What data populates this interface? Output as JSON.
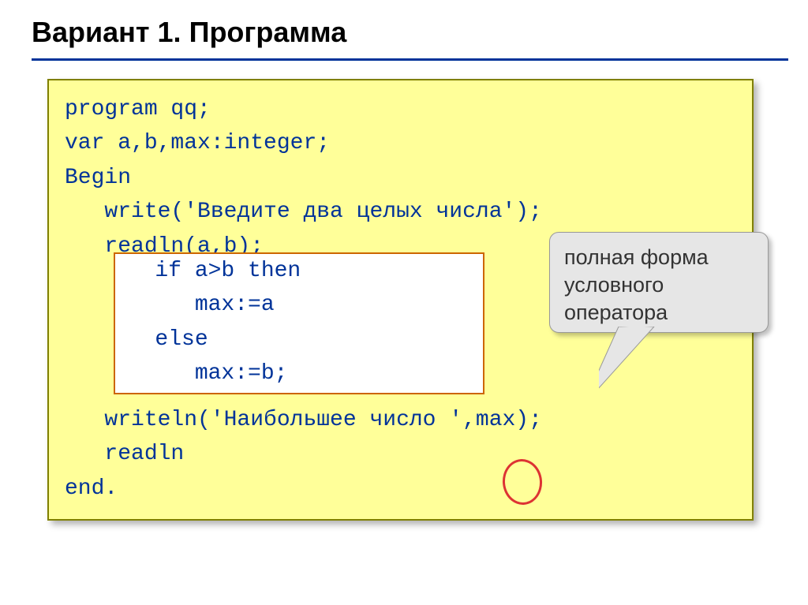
{
  "title": "Вариант 1. Программа",
  "code": {
    "l1": "program qq;",
    "l2": "var a,b,max:integer;",
    "l3": "Begin",
    "l4": "   write('Введите два целых числа');",
    "l5": "   readln(a,b);",
    "l6": "   if a>b then",
    "l7": "      max:=a",
    "l8": "   else",
    "l9": "      max:=b;",
    "l10": "   writeln('Наибольшее число ',max);",
    "l11": "   readln",
    "l12": "end."
  },
  "callout": {
    "line1": "полная форма",
    "line2": "условного",
    "line3": "оператора"
  }
}
